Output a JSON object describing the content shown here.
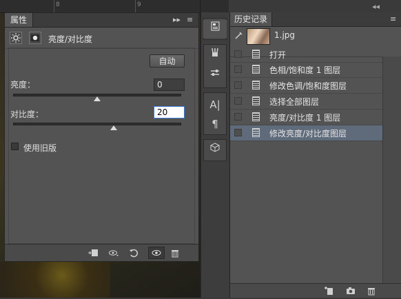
{
  "ruler": {
    "marks": [
      "8",
      "9"
    ]
  },
  "properties": {
    "tab_label": "属性",
    "collapse_glyph": "▸▸",
    "menu_glyph": "≡",
    "title": "亮度/对比度",
    "auto_label": "自动",
    "brightness_label": "亮度：",
    "brightness_value": "0",
    "brightness_level": 0.5,
    "contrast_label": "对比度：",
    "contrast_value": "20",
    "contrast_level": 0.6,
    "legacy_label": "使用旧版"
  },
  "history": {
    "tab_label": "历史记录",
    "collapse_glyph": "◂◂",
    "snapshot_name": "1.jpg",
    "steps": [
      {
        "label": "打开",
        "selected": false
      },
      {
        "label": "色相/饱和度 1 图层",
        "selected": false
      },
      {
        "label": "修改色调/饱和度图层",
        "selected": false
      },
      {
        "label": "选择全部图层",
        "selected": false
      },
      {
        "label": "亮度/对比度 1 图层",
        "selected": false
      },
      {
        "label": "修改亮度/对比度图层",
        "selected": true
      }
    ]
  }
}
